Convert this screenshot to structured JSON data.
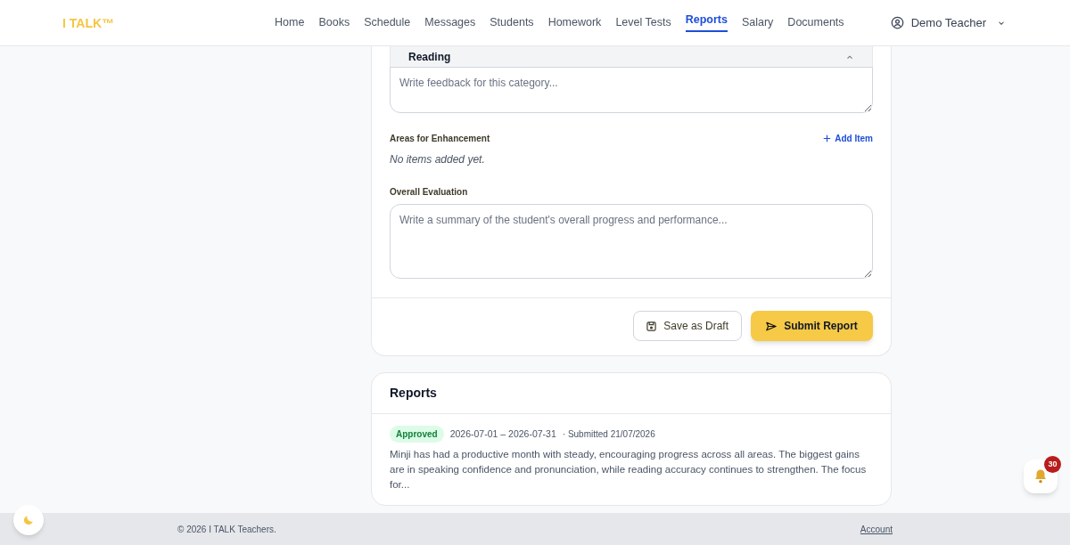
{
  "brand": "I TALK™",
  "nav": [
    {
      "label": "Home",
      "selected": false
    },
    {
      "label": "Books",
      "selected": false
    },
    {
      "label": "Schedule",
      "selected": false
    },
    {
      "label": "Messages",
      "selected": false
    },
    {
      "label": "Students",
      "selected": false
    },
    {
      "label": "Homework",
      "selected": false
    },
    {
      "label": "Level Tests",
      "selected": false
    },
    {
      "label": "Reports",
      "selected": true
    },
    {
      "label": "Salary",
      "selected": false
    },
    {
      "label": "Documents",
      "selected": false
    }
  ],
  "user": "Demo Teacher",
  "category": {
    "title": "Reading",
    "placeholder": "Write feedback for this category..."
  },
  "enhancement": {
    "label": "Areas for Enhancement",
    "add": "Add Item",
    "empty": "No items added yet."
  },
  "overall": {
    "label": "Overall Evaluation",
    "placeholder": "Write a summary of the student's overall progress and performance..."
  },
  "buttons": {
    "draft": "Save as Draft",
    "submit": "Submit Report"
  },
  "reports": {
    "title": "Reports",
    "items": [
      {
        "status": "Approved",
        "period": "2026-07-01 – 2026-07-31",
        "submitted": "· Submitted 21/07/2026",
        "summary": "Minji has had a productive month with steady, encouraging progress across all areas. The biggest gains are in speaking confidence and pronunciation, while reading accuracy continues to strengthen. The focus for..."
      }
    ]
  },
  "notifications": "30",
  "footer": {
    "copyright": "© 2026 I TALK Teachers.",
    "link": "Account"
  }
}
